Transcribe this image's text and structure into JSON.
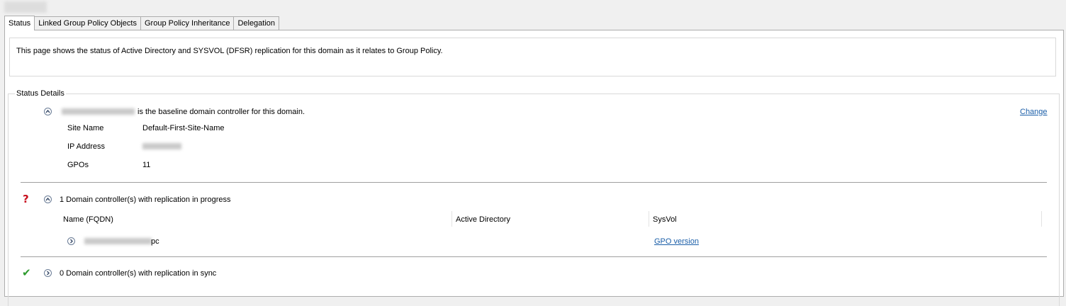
{
  "tabs": [
    {
      "label": "Status",
      "active": true
    },
    {
      "label": "Linked Group Policy Objects",
      "active": false
    },
    {
      "label": "Group Policy Inheritance",
      "active": false
    },
    {
      "label": "Delegation",
      "active": false
    }
  ],
  "description": "This page shows the status of Active Directory and SYSVOL (DFSR) replication for this domain as it relates to Group Policy.",
  "status_details": {
    "legend": "Status Details",
    "baseline": {
      "text": "is the baseline domain controller for this domain.",
      "change_link": "Change",
      "fields": [
        {
          "label": "Site Name",
          "value": "Default-First-Site-Name"
        },
        {
          "label": "IP Address",
          "value": ""
        },
        {
          "label": "GPOs",
          "value": "11"
        }
      ]
    },
    "in_progress": {
      "text": "1 Domain controller(s) with replication in progress",
      "columns": [
        "Name (FQDN)",
        "Active Directory",
        "SysVol"
      ],
      "rows": [
        {
          "name_suffix": "pc",
          "active_directory": "",
          "sysvol_link": "GPO version"
        }
      ]
    },
    "in_sync": {
      "text": "0 Domain controller(s) with replication in sync"
    }
  },
  "icons": {
    "in_progress": "question-mark-icon",
    "in_sync": "checkmark-icon"
  },
  "colors": {
    "link": "#1a5ea8",
    "question": "#c8101e",
    "check": "#2e9b2e"
  }
}
